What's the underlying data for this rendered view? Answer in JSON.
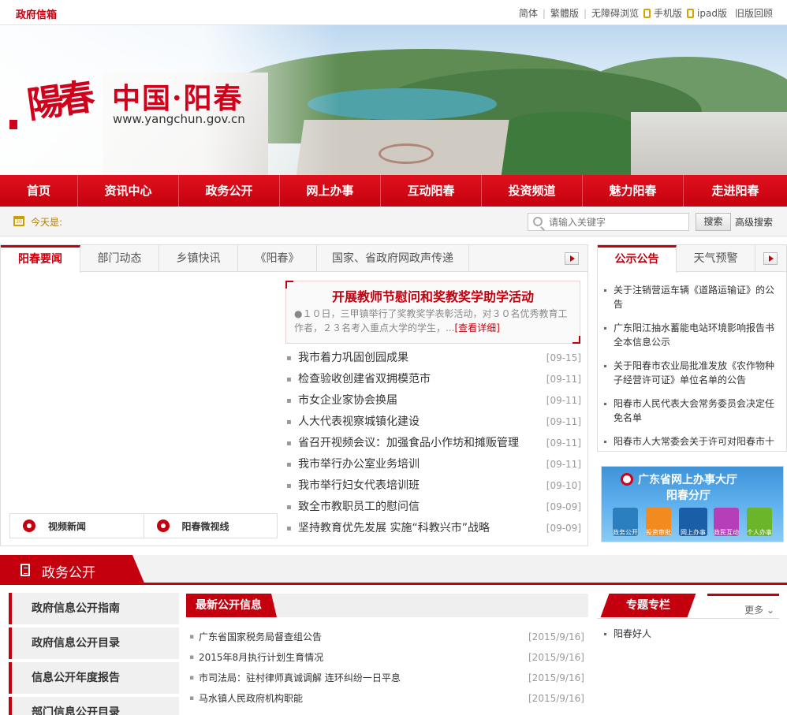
{
  "topbar": {
    "mail": "政府信箱",
    "links": [
      "简体",
      "繁體版",
      "无障碍浏览"
    ],
    "mobile": "手机版",
    "ipad": "ipad版",
    "old": "旧版回顾"
  },
  "banner": {
    "calligraphy": "陽春",
    "title": "中国·阳春",
    "url": "www.yangchun.gov.cn"
  },
  "nav": {
    "items": [
      "首页",
      "资讯中心",
      "政务公开",
      "网上办事",
      "互动阳春",
      "投资频道",
      "魅力阳春",
      "走进阳春"
    ]
  },
  "search": {
    "today_label": "今天是:",
    "placeholder": "请输入关键字",
    "button": "搜索",
    "advanced": "高级搜索"
  },
  "news": {
    "tabs": [
      "阳春要闻",
      "部门动态",
      "乡镇快讯",
      "《阳春》",
      "国家、省政府网政声传递"
    ],
    "headline": {
      "title": "开展教师节慰问和奖教奖学助学活动",
      "summary": "●１０日，三甲镇举行了奖教奖学表彰活动，对３０名优秀教育工作者，２３名考入重点大学的学生，...",
      "more": "[查看详细]"
    },
    "items": [
      {
        "title": "我市着力巩固创园成果",
        "date": "[09-15]"
      },
      {
        "title": "检查验收创建省双拥模范市",
        "date": "[09-11]"
      },
      {
        "title": "市女企业家协会换届",
        "date": "[09-11]"
      },
      {
        "title": "人大代表视察城镇化建设",
        "date": "[09-11]"
      },
      {
        "title": "省召开视频会议：加强食品小作坊和摊贩管理",
        "date": "[09-11]"
      },
      {
        "title": "我市举行办公室业务培训",
        "date": "[09-11]"
      },
      {
        "title": "我市举行妇女代表培训班",
        "date": "[09-10]"
      },
      {
        "title": "致全市教职员工的慰问信",
        "date": "[09-09]"
      },
      {
        "title": "坚持教育优先发展 实施“科教兴市”战略",
        "date": "[09-09]"
      }
    ],
    "video_news": "视频新闻",
    "micro_video": "阳春微视线"
  },
  "notice": {
    "tabs": [
      "公示公告",
      "天气预警"
    ],
    "items": [
      "关于注销营运车辆《道路运输证》的公告",
      "广东阳江抽水蓄能电站环境影响报告书全本信息公示",
      "关于阳春市农业局批准发放《农作物种子经营许可证》单位名单的公告",
      "阳春市人民代表大会常务委员会决定任免名单",
      "阳春市人大常委会关于许可对阳春市十"
    ]
  },
  "hall": {
    "line1": "广东省网上办事大厅",
    "line2": "阳春分厅",
    "icons": [
      "政务公开",
      "投资审批",
      "网上办事",
      "政民互动",
      "个人办事"
    ],
    "colors": [
      "#2c7fbf",
      "#f28a1f",
      "#1a5ea8",
      "#b43fb9",
      "#6bb52b"
    ]
  },
  "gov": {
    "section_title": "政务公开",
    "menu": [
      "政府信息公开指南",
      "政府信息公开目录",
      "信息公开年度报告",
      "部门信息公开目录"
    ],
    "latest_title": "最新公开信息",
    "latest": [
      {
        "title": "广东省国家税务局督查组公告",
        "date": "[2015/9/16]"
      },
      {
        "title": "2015年8月执行计划生育情况",
        "date": "[2015/9/16]"
      },
      {
        "title": "市司法局：驻村律师真诚调解 连环纠纷一日平息",
        "date": "[2015/9/16]"
      },
      {
        "title": "马水镇人民政府机构职能",
        "date": "[2015/9/16]"
      }
    ],
    "topic_title": "专题专栏",
    "topic_more": "更多",
    "topics": [
      "阳春好人"
    ]
  },
  "colors": {
    "brand_red": "#c4000f",
    "nav_red": "#d4081a"
  }
}
